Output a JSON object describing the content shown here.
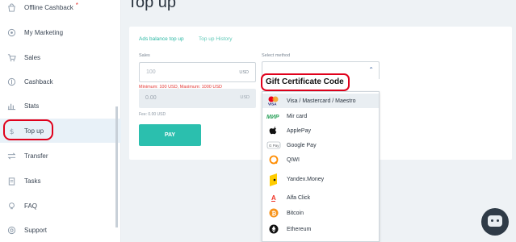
{
  "sidebar": {
    "items": [
      {
        "label": "Offline Cashback",
        "icon": "shopping-bag-icon",
        "starred": true
      },
      {
        "label": "My Marketing",
        "icon": "marketing-icon"
      },
      {
        "label": "Sales",
        "icon": "cart-icon"
      },
      {
        "label": "Cashback",
        "icon": "coin-icon"
      },
      {
        "label": "Stats",
        "icon": "bar-chart-icon"
      },
      {
        "label": "Top up",
        "icon": "dollar-icon",
        "active": true
      },
      {
        "label": "Transfer",
        "icon": "transfer-icon"
      },
      {
        "label": "Tasks",
        "icon": "clipboard-icon"
      },
      {
        "label": "FAQ",
        "icon": "lightbulb-icon"
      },
      {
        "label": "Support",
        "icon": "support-icon"
      }
    ],
    "star_mark": "*"
  },
  "page": {
    "title": "Top up"
  },
  "tabs": {
    "active": "Ads balance top up",
    "inactive": "Top up History"
  },
  "form": {
    "sales_label": "Sales",
    "sales_placeholder": "100",
    "sales_currency": "USD",
    "error": "Minimum: 100 USD, Maximum: 1000 USD",
    "sum_value": "0.00",
    "sum_currency": "USD",
    "fee": "Fee: 0.00 USD",
    "pay_label": "PAY"
  },
  "method": {
    "label": "Select method",
    "annotation": "Gift Certificate Code",
    "options": [
      {
        "label": "Visa / Mastercard / Maestro",
        "icon": "visa-mastercard-icon",
        "selected": true
      },
      {
        "label": "Mir card",
        "icon": "mir-icon"
      },
      {
        "label": "ApplePay",
        "icon": "apple-icon"
      },
      {
        "label": "Google Pay",
        "icon": "google-pay-icon"
      },
      {
        "label": "QIWI",
        "icon": "qiwi-icon"
      },
      {
        "label": "Yandex.Money",
        "icon": "yandex-money-icon"
      },
      {
        "label": "Alfa Click",
        "icon": "alfa-icon"
      },
      {
        "label": "Bitcoin",
        "icon": "bitcoin-icon"
      },
      {
        "label": "Ethereum",
        "icon": "ethereum-icon"
      }
    ]
  },
  "colors": {
    "accent": "#2bbfae",
    "annotation_red": "#e0001b",
    "error_red": "#e53935"
  }
}
